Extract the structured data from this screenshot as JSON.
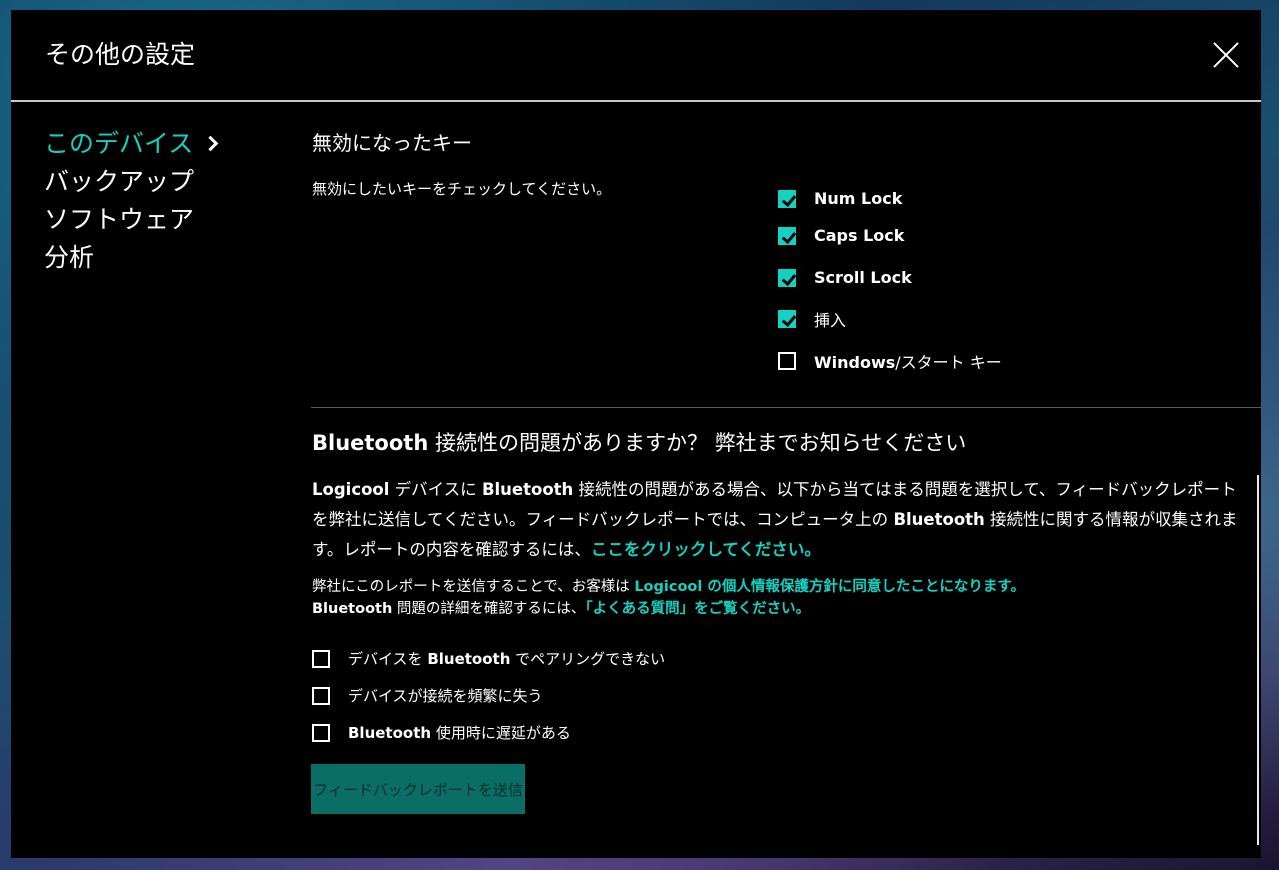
{
  "dialog": {
    "title": "その他の設定"
  },
  "nav": {
    "items": [
      {
        "label": "このデバイス",
        "active": true
      },
      {
        "label": "バックアップ"
      },
      {
        "label": "ソフトウェア"
      },
      {
        "label": "分析"
      }
    ]
  },
  "disabled_keys": {
    "title": "無効になったキー",
    "description": "無効にしたいキーをチェックしてください。",
    "keys": [
      {
        "label": "Num Lock",
        "checked": true
      },
      {
        "label": "Caps Lock",
        "checked": true
      },
      {
        "label": "Scroll Lock",
        "checked": true
      },
      {
        "label": "挿入",
        "checked": true
      },
      {
        "label_bold": "Windows",
        "label_rest": "/スタート キー",
        "checked": false
      }
    ]
  },
  "bluetooth": {
    "title_bold": "Bluetooth",
    "title_rest": " 接続性の問題がありますか？ 弊社までお知らせください",
    "desc": {
      "p1_bold": "Logicool",
      "p1": " デバイスに ",
      "p2_bold": "Bluetooth",
      "p2": " 接続性の問題がある場合、以下から当てはまる問題を選択して、フィードバックレポートを弊社に送信してください。フィードバックレポートでは、コンピュータ上の ",
      "p3_bold": "Bluetooth",
      "p3": " 接続性に関する情報が収集されます。レポートの内容を確認するには、",
      "link": "ここをクリックしてください。"
    },
    "consent": {
      "line1_text": "弊社にこのレポートを送信することで、お客様は ",
      "line1_link": "Logicool の個人情報保護方針に同意したことになります。",
      "line2_bold": "Bluetooth",
      "line2_text": " 問題の詳細を確認するには、",
      "line2_link": "「よくある質問」をご覧ください。"
    },
    "issues": [
      {
        "pre": "デバイスを ",
        "bold": "Bluetooth",
        "post": " でペアリングできない",
        "checked": false
      },
      {
        "pre": "デバイスが接続を頻繁に失う",
        "bold": "",
        "post": "",
        "checked": false
      },
      {
        "pre": "",
        "bold": "Bluetooth",
        "post": " 使用時に遅延がある",
        "checked": false
      }
    ],
    "submit_label": "フィードバックレポートを送信"
  },
  "colors": {
    "accent": "#14d2c2",
    "button_bg": "#0a6e66",
    "dialog_bg": "#000000"
  },
  "icons": {
    "close": "close-icon",
    "nav_active": "chevron-right-icon",
    "checkbox_checked": "check-icon"
  }
}
